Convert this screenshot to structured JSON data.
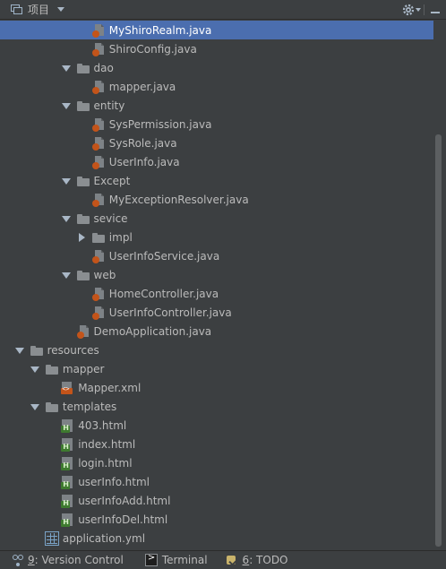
{
  "header": {
    "title": "项目",
    "view_icon": "project-view-icon",
    "settings_icon": "gear-icon",
    "hide_icon": "minimize-icon"
  },
  "tree": {
    "rows": [
      {
        "label": "MyShiroRealm.java",
        "type": "java",
        "depth": 6,
        "arrow": "none",
        "selected": true
      },
      {
        "label": "ShiroConfig.java",
        "type": "java",
        "depth": 6,
        "arrow": "none"
      },
      {
        "label": "dao",
        "type": "folder",
        "depth": 5,
        "arrow": "down"
      },
      {
        "label": "mapper.java",
        "type": "java",
        "depth": 6,
        "arrow": "none"
      },
      {
        "label": "entity",
        "type": "folder",
        "depth": 5,
        "arrow": "down"
      },
      {
        "label": "SysPermission.java",
        "type": "java",
        "depth": 6,
        "arrow": "none"
      },
      {
        "label": "SysRole.java",
        "type": "java",
        "depth": 6,
        "arrow": "none"
      },
      {
        "label": "UserInfo.java",
        "type": "java",
        "depth": 6,
        "arrow": "none"
      },
      {
        "label": "Except",
        "type": "folder",
        "depth": 5,
        "arrow": "down"
      },
      {
        "label": "MyExceptionResolver.java",
        "type": "java",
        "depth": 6,
        "arrow": "none"
      },
      {
        "label": "sevice",
        "type": "folder",
        "depth": 5,
        "arrow": "down"
      },
      {
        "label": "impl",
        "type": "folder",
        "depth": 6,
        "arrow": "right"
      },
      {
        "label": "UserInfoService.java",
        "type": "java",
        "depth": 6,
        "arrow": "none"
      },
      {
        "label": "web",
        "type": "folder",
        "depth": 5,
        "arrow": "down"
      },
      {
        "label": "HomeController.java",
        "type": "java",
        "depth": 6,
        "arrow": "none"
      },
      {
        "label": "UserInfoController.java",
        "type": "java",
        "depth": 6,
        "arrow": "none"
      },
      {
        "label": "DemoApplication.java",
        "type": "java",
        "depth": 5,
        "arrow": "none"
      },
      {
        "label": "resources",
        "type": "folder",
        "depth": 2,
        "arrow": "down"
      },
      {
        "label": "mapper",
        "type": "folder",
        "depth": 3,
        "arrow": "down"
      },
      {
        "label": "Mapper.xml",
        "type": "xml",
        "depth": 4,
        "arrow": "none"
      },
      {
        "label": "templates",
        "type": "folder",
        "depth": 3,
        "arrow": "down"
      },
      {
        "label": "403.html",
        "type": "html",
        "depth": 4,
        "arrow": "none"
      },
      {
        "label": "index.html",
        "type": "html",
        "depth": 4,
        "arrow": "none"
      },
      {
        "label": "login.html",
        "type": "html",
        "depth": 4,
        "arrow": "none"
      },
      {
        "label": "userInfo.html",
        "type": "html",
        "depth": 4,
        "arrow": "none"
      },
      {
        "label": "userInfoAdd.html",
        "type": "html",
        "depth": 4,
        "arrow": "none"
      },
      {
        "label": "userInfoDel.html",
        "type": "html",
        "depth": 4,
        "arrow": "none"
      },
      {
        "label": "application.yml",
        "type": "yml",
        "depth": 3,
        "arrow": "none"
      }
    ]
  },
  "bottom_bar": {
    "version_control": {
      "mnemonic": "9",
      "label": ": Version Control",
      "icon": "version-control-icon"
    },
    "terminal": {
      "label": "Terminal",
      "icon": "terminal-icon"
    },
    "todo": {
      "mnemonic": "6",
      "label": ": TODO",
      "icon": "todo-icon"
    }
  },
  "colors": {
    "background": "#3c3f41",
    "selection": "#4b6eaf",
    "text": "#bbbbbb",
    "java_badge": "#c3541a",
    "html_badge": "#3e7a2f"
  }
}
